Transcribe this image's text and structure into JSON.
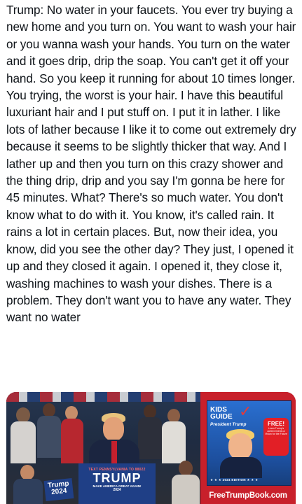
{
  "post": {
    "text": "Trump: No water in your faucets. You ever try buying a new home and you turn on. You want to wash your hair or you wanna wash your hands. You turn on the water and it goes drip, drip the soap. You can't get it off your hand. So you keep it running for about 10 times longer. You trying, the worst is your hair. I have this beautiful luxuriant hair and I put stuff on. I put it in lather. I like lots of lather because I like it to come out extremely dry because it seems to be slightly thicker that way. And I lather up and then you turn on this crazy shower and the thing drip, drip and you say I'm gonna be here for 45 minutes. What? There's so much water. You don't know what to do with it. You know, it's called rain. It rains a lot in certain places. But, now their idea, you know, did you see the other day? They just, I opened it up and they closed it again. I opened it, they close it, washing machines to wash your dishes. There is a problem. They don't want you to have any water. They want no water"
  },
  "media": {
    "podium": {
      "text_line": "TEXT PENNSYLVANIA TO 88022",
      "name": "TRUMP",
      "slogan": "MAKE AMERICA GREAT AGAIN!",
      "year": "2024"
    },
    "sign": {
      "name": "Trump",
      "year": "2024"
    },
    "ad": {
      "kids": "KIDS",
      "guide": "GUIDE",
      "subtitle": "President Trump",
      "free": "FREE!",
      "free_detail": "Learn Trump's Achievements & Vision for the Future",
      "edition": "★ ★ ★ 2024 EDITION ★ ★ ★",
      "website": "FreeTrumpBook.com"
    },
    "colors": {
      "ad_red": "#c8202b",
      "podium_blue": "#1f3f86"
    }
  }
}
